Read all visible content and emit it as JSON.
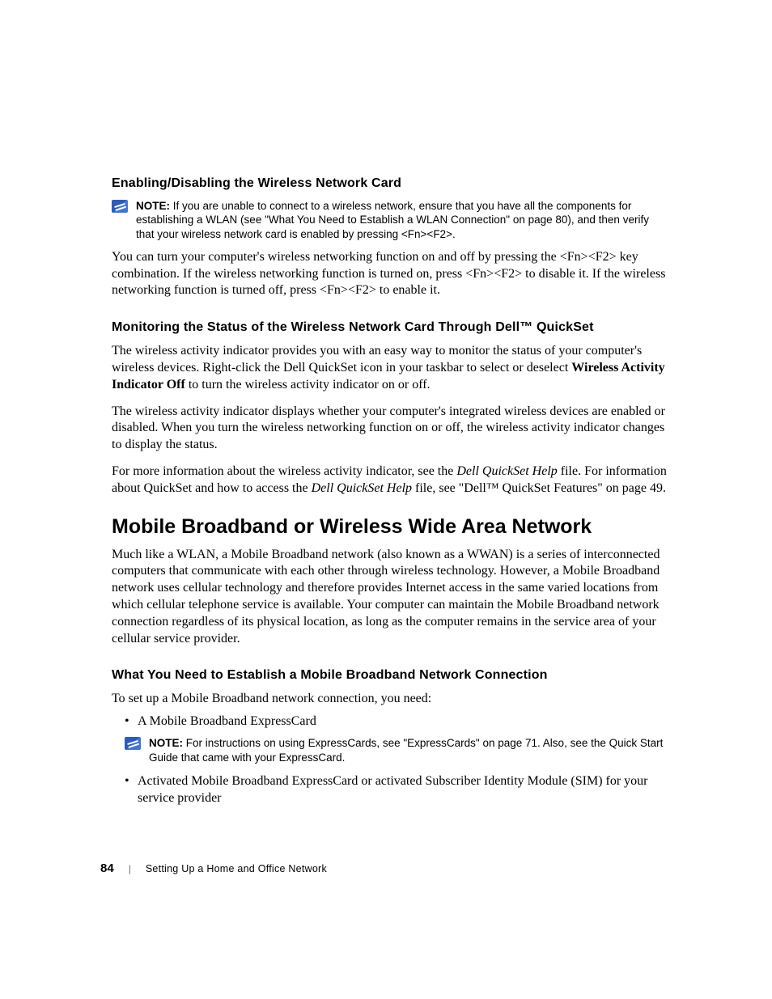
{
  "section1": {
    "heading": "Enabling/Disabling the Wireless Network Card",
    "note_label": "NOTE:",
    "note_text": " If you are unable to connect to a wireless network, ensure that you have all the components for establishing a WLAN (see \"What You Need to Establish a WLAN Connection\" on page 80), and then verify that your wireless network card is enabled by pressing <Fn><F2>.",
    "para": "You can turn your computer's wireless networking function on and off by pressing the <Fn><F2> key combination. If the wireless networking function is turned on, press <Fn><F2> to disable it. If the wireless networking function is turned off, press <Fn><F2> to enable it."
  },
  "section2": {
    "heading": "Monitoring the Status of the Wireless Network Card Through Dell™ QuickSet",
    "para1_a": "The wireless activity indicator provides you with an easy way to monitor the status of your computer's wireless devices. Right-click the Dell QuickSet icon in your taskbar to select or deselect ",
    "para1_bold": "Wireless Activity Indicator Off",
    "para1_b": " to turn the wireless activity indicator on or off.",
    "para2": "The wireless activity indicator displays whether your computer's integrated wireless devices are enabled or disabled. When you turn the wireless networking function on or off, the wireless activity indicator changes to display the status.",
    "para3_a": "For more information about the wireless activity indicator, see the ",
    "para3_i1": "Dell QuickSet Help",
    "para3_b": " file. For information about QuickSet and how to access the ",
    "para3_i2": "Dell QuickSet Help",
    "para3_c": " file, see \"Dell™ QuickSet Features\" on page 49."
  },
  "main": {
    "heading": "Mobile Broadband or Wireless Wide Area Network",
    "para": "Much like a WLAN, a Mobile Broadband network (also known as a WWAN) is a series of interconnected computers that communicate with each other through wireless technology. However, a Mobile Broadband network uses cellular technology and therefore provides Internet access in the same varied locations from which cellular telephone service is available. Your computer can maintain the Mobile Broadband network connection regardless of its physical location, as long as the computer remains in the service area of your cellular service provider."
  },
  "section3": {
    "heading": "What You Need to Establish a Mobile Broadband Network Connection",
    "intro": "To set up a Mobile Broadband network connection, you need:",
    "bullet1": "A Mobile Broadband ExpressCard",
    "note_label": "NOTE:",
    "note_text": " For instructions on using ExpressCards, see \"ExpressCards\" on page 71. Also, see the Quick Start Guide that came with your ExpressCard.",
    "bullet2": "Activated Mobile Broadband ExpressCard or activated Subscriber Identity Module (SIM) for your service provider"
  },
  "footer": {
    "page": "84",
    "separator": "|",
    "title": "Setting Up a Home and Office Network"
  }
}
